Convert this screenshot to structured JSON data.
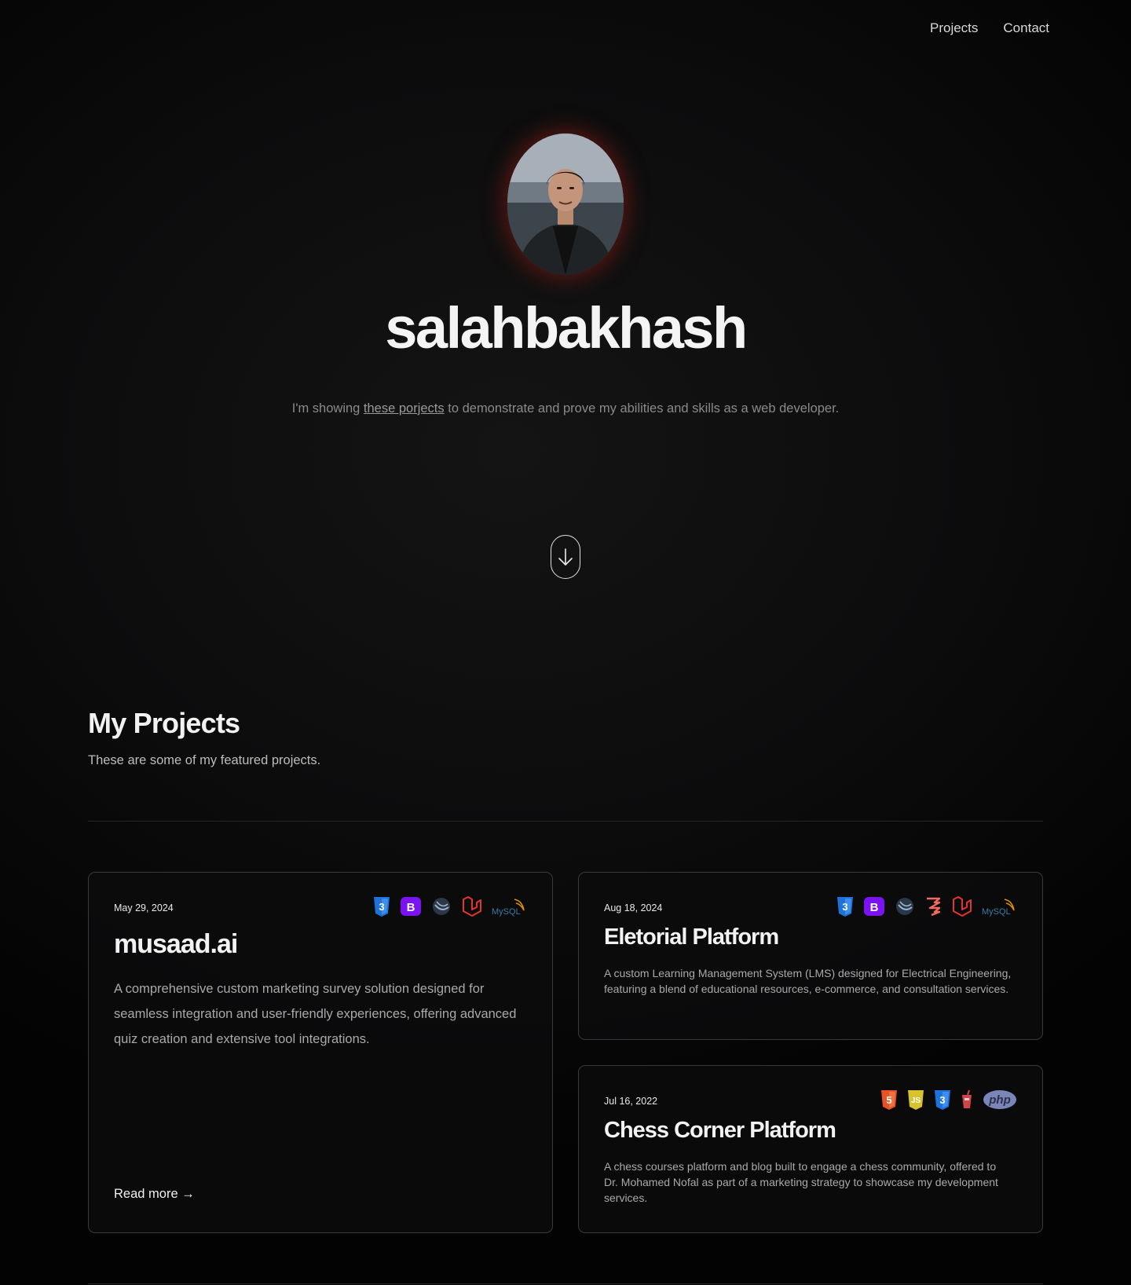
{
  "nav": {
    "projects": "Projects",
    "contact": "Contact"
  },
  "hero": {
    "name": "salahbakhash",
    "sub_before": "I'm showing ",
    "sub_link": "these porjects",
    "sub_after": " to demonstrate and prove my abilities and skills as a web developer."
  },
  "projects_section": {
    "title": "My Projects",
    "subtitle": "These are some of my featured projects."
  },
  "projects": [
    {
      "date": "May 29, 2024",
      "title": "musaad.ai",
      "description": "A comprehensive custom marketing survey solution designed for seamless integration and user-friendly experiences, offering advanced quiz creation and extensive tool integrations.",
      "read_more": "Read more →",
      "icons": [
        "css3-icon",
        "bootstrap-icon",
        "jquery-icon",
        "laravel-icon",
        "mysql-icon"
      ]
    },
    {
      "date": "Aug 18, 2024",
      "title": "Eletorial Platform",
      "description": "A custom Learning Management System (LMS) designed for Electrical Engineering, featuring a blend of educational resources, e-commerce, and consultation services.",
      "icons": [
        "css3-icon",
        "bootstrap-icon",
        "jquery-icon",
        "livewire-icon",
        "laravel-icon",
        "mysql-icon"
      ]
    },
    {
      "date": "Jul 16, 2022",
      "title": "Chess Corner Platform",
      "description": "A chess courses platform and blog built to engage a chess community, offered to Dr. Mohamed Nofal as part of a marketing strategy to showcase my development services.",
      "icons": [
        "html5-icon",
        "javascript-icon",
        "css3-icon",
        "gulp-icon",
        "php-icon"
      ]
    }
  ],
  "icon_labels": {
    "bootstrap": "B",
    "javascript": "JS",
    "php": "php",
    "mysql": "MySQL"
  },
  "colors": {
    "css3": "#1f73d8",
    "bootstrap": "#7b12f2",
    "laravel": "#e3342f",
    "html5": "#e65128",
    "javascript": "#d8c22e",
    "php": "#7a86b8",
    "mysql_blue": "#3b7aa8",
    "mysql_orange": "#e48e00"
  }
}
